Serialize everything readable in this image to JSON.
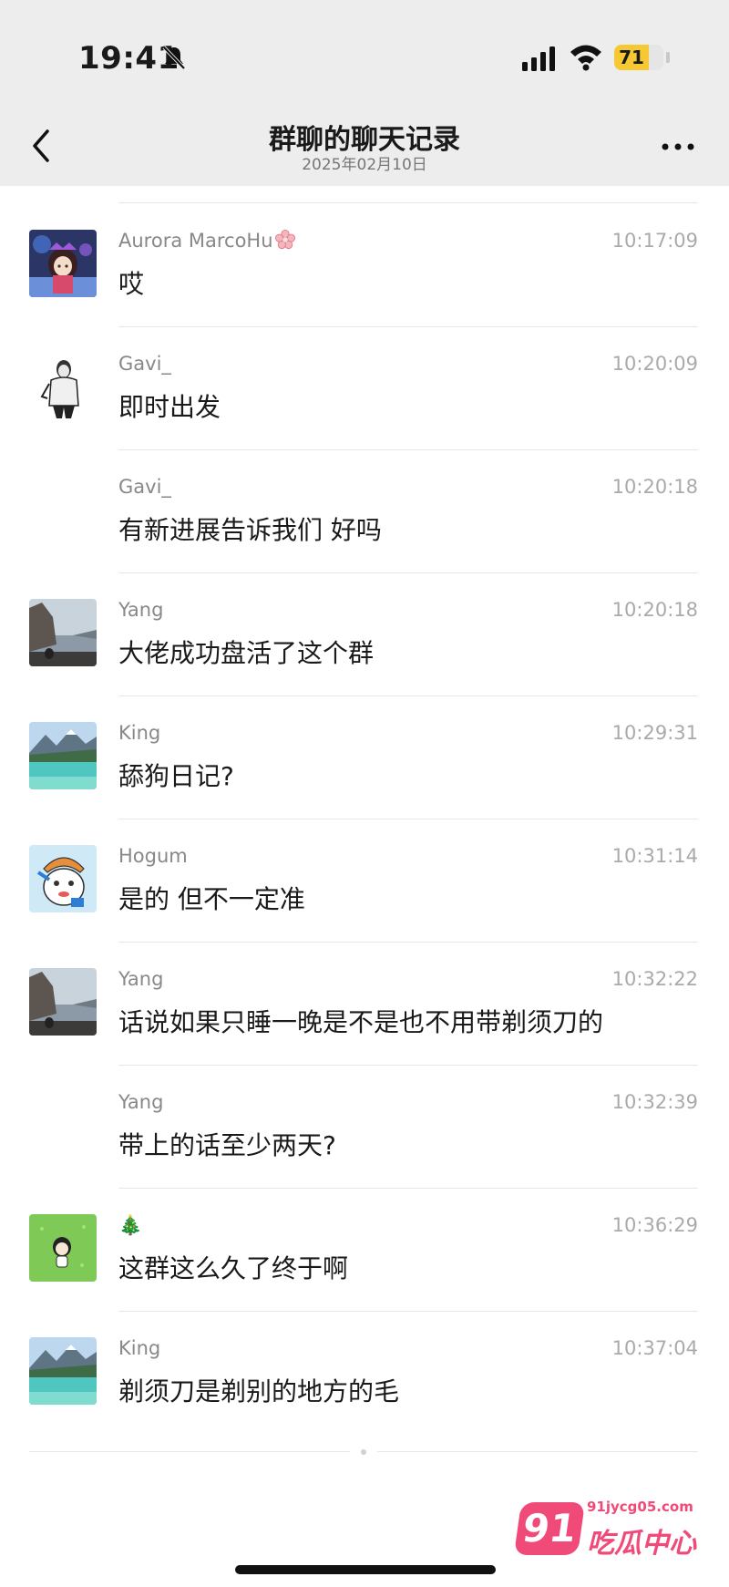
{
  "status_bar": {
    "time": "19:41",
    "battery": "71",
    "battery_level_percent": 71,
    "icons": [
      "bell-muted-icon",
      "signal-icon",
      "wifi-icon",
      "battery-icon"
    ]
  },
  "nav": {
    "title": "群聊的聊天记录",
    "date": "2025年02月10日",
    "icons": [
      "back-chevron-icon",
      "more-icon"
    ]
  },
  "messages": [
    {
      "sender": "Aurora MarcoHu",
      "time": "10:17:09",
      "text": "哎",
      "avatar": "anime-girl-avatar",
      "has_flower_emoji": true
    },
    {
      "sender": "Gavi_",
      "time": "10:20:09",
      "text": "即时出发",
      "avatar": "person-sketch-avatar"
    },
    {
      "sender": "Gavi_",
      "time": "10:20:18",
      "text": "有新进展告诉我们 好吗",
      "avatar": ""
    },
    {
      "sender": "Yang",
      "time": "10:20:18",
      "text": "大佬成功盘活了这个群",
      "avatar": "seaside-rock-avatar"
    },
    {
      "sender": "King",
      "time": "10:29:31",
      "text": "舔狗日记?",
      "avatar": "lake-mountain-avatar"
    },
    {
      "sender": "Hogum",
      "time": "10:31:14",
      "text": "是的 但不一定准",
      "avatar": "cartoon-avatar"
    },
    {
      "sender": "Yang",
      "time": "10:32:22",
      "text": "话说如果只睡一晚是不是也不用带剃须刀的",
      "avatar": "seaside-rock-avatar"
    },
    {
      "sender": "Yang",
      "time": "10:32:39",
      "text": "带上的话至少两天?",
      "avatar": ""
    },
    {
      "sender": "🎄",
      "time": "10:36:29",
      "text": "这群这么久了终于啊",
      "avatar": "grass-figure-avatar"
    },
    {
      "sender": "King",
      "time": "10:37:04",
      "text": "剃须刀是剃别的地方的毛",
      "avatar": "lake-mountain-avatar"
    }
  ],
  "watermark": {
    "badge": "91",
    "url": "91jycg05.com",
    "name": "吃瓜中心",
    "color": "#ef4a78"
  }
}
